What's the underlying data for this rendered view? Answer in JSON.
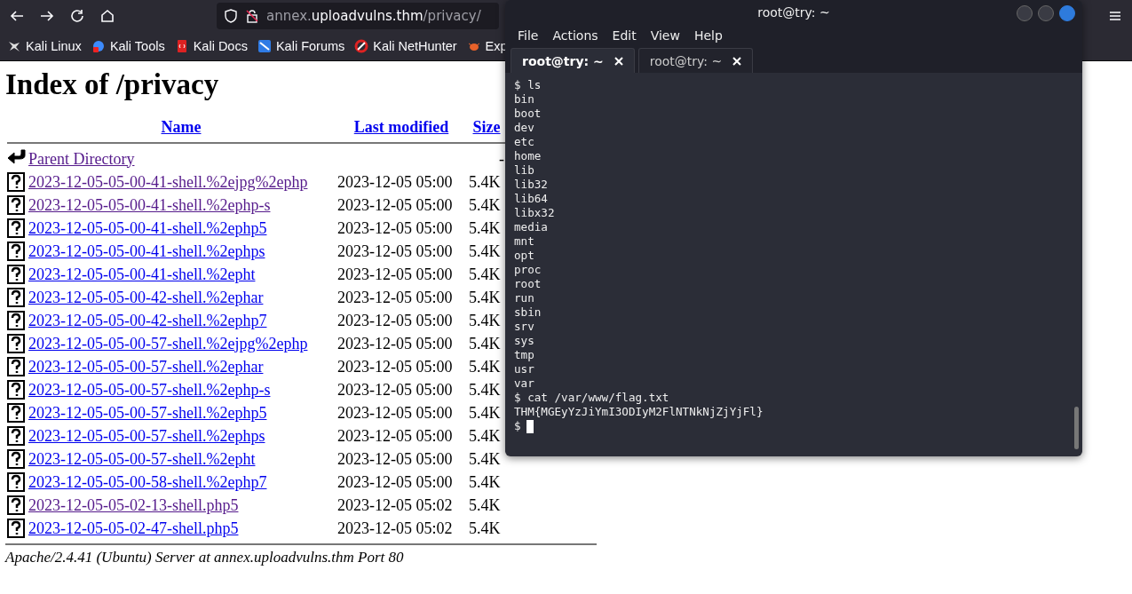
{
  "browser": {
    "url_host_prefix": "annex.",
    "url_host": "uploadvulns.thm",
    "url_path": "/privacy/",
    "bookmarks": [
      {
        "label": "Kali Linux",
        "kind": "dragon"
      },
      {
        "label": "Kali Tools",
        "kind": "tools"
      },
      {
        "label": "Kali Docs",
        "kind": "docs"
      },
      {
        "label": "Kali Forums",
        "kind": "forums"
      },
      {
        "label": "Kali NetHunter",
        "kind": "nethunter"
      },
      {
        "label": "Exp",
        "kind": "bug"
      }
    ]
  },
  "page": {
    "title": "Index of /privacy",
    "columns": [
      "Name",
      "Last modified",
      "Size"
    ],
    "parent": {
      "name": "Parent Directory",
      "size": "-",
      "visited": true
    },
    "rows": [
      {
        "name": "2023-12-05-05-00-41-shell.%2ejpg%2ephp",
        "modified": "2023-12-05 05:00",
        "size": "5.4K",
        "visited": true
      },
      {
        "name": "2023-12-05-05-00-41-shell.%2ephp-s",
        "modified": "2023-12-05 05:00",
        "size": "5.4K",
        "visited": true
      },
      {
        "name": "2023-12-05-05-00-41-shell.%2ephp5",
        "modified": "2023-12-05 05:00",
        "size": "5.4K",
        "visited": false
      },
      {
        "name": "2023-12-05-05-00-41-shell.%2ephps",
        "modified": "2023-12-05 05:00",
        "size": "5.4K",
        "visited": false
      },
      {
        "name": "2023-12-05-05-00-41-shell.%2epht",
        "modified": "2023-12-05 05:00",
        "size": "5.4K",
        "visited": false
      },
      {
        "name": "2023-12-05-05-00-42-shell.%2ephar",
        "modified": "2023-12-05 05:00",
        "size": "5.4K",
        "visited": false
      },
      {
        "name": "2023-12-05-05-00-42-shell.%2ephp7",
        "modified": "2023-12-05 05:00",
        "size": "5.4K",
        "visited": false
      },
      {
        "name": "2023-12-05-05-00-57-shell.%2ejpg%2ephp",
        "modified": "2023-12-05 05:00",
        "size": "5.4K",
        "visited": false
      },
      {
        "name": "2023-12-05-05-00-57-shell.%2ephar",
        "modified": "2023-12-05 05:00",
        "size": "5.4K",
        "visited": false
      },
      {
        "name": "2023-12-05-05-00-57-shell.%2ephp-s",
        "modified": "2023-12-05 05:00",
        "size": "5.4K",
        "visited": false
      },
      {
        "name": "2023-12-05-05-00-57-shell.%2ephp5",
        "modified": "2023-12-05 05:00",
        "size": "5.4K",
        "visited": false
      },
      {
        "name": "2023-12-05-05-00-57-shell.%2ephps",
        "modified": "2023-12-05 05:00",
        "size": "5.4K",
        "visited": false
      },
      {
        "name": "2023-12-05-05-00-57-shell.%2epht",
        "modified": "2023-12-05 05:00",
        "size": "5.4K",
        "visited": false
      },
      {
        "name": "2023-12-05-05-00-58-shell.%2ephp7",
        "modified": "2023-12-05 05:00",
        "size": "5.4K",
        "visited": false
      },
      {
        "name": "2023-12-05-05-02-13-shell.php5",
        "modified": "2023-12-05 05:02",
        "size": "5.4K",
        "visited": true
      },
      {
        "name": "2023-12-05-05-02-47-shell.php5",
        "modified": "2023-12-05 05:02",
        "size": "5.4K",
        "visited": false
      }
    ],
    "footer": "Apache/2.4.41 (Ubuntu) Server at annex.uploadvulns.thm Port 80"
  },
  "terminal": {
    "title": "root@try: ~",
    "menu": [
      "File",
      "Actions",
      "Edit",
      "View",
      "Help"
    ],
    "tabs": [
      {
        "label": "root@try: ~",
        "selected": true
      },
      {
        "label": "root@try: ~",
        "selected": false
      }
    ],
    "lines": [
      "$ ls",
      "bin",
      "boot",
      "dev",
      "etc",
      "home",
      "lib",
      "lib32",
      "lib64",
      "libx32",
      "media",
      "mnt",
      "opt",
      "proc",
      "root",
      "run",
      "sbin",
      "srv",
      "sys",
      "tmp",
      "usr",
      "var",
      "$ cat /var/www/flag.txt",
      "THM{MGEyYzJiYmI3ODIyM2FlNTNkNjZjYjFl}"
    ],
    "prompt": "$"
  }
}
